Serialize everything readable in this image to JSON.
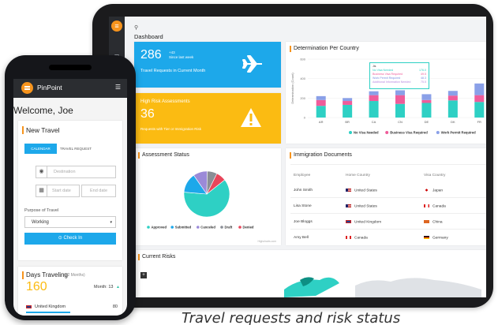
{
  "caption": "Travel requests and risk status",
  "dashboard": {
    "title": "Dashboard",
    "travel_card": {
      "number": "286",
      "delta": "+43",
      "delta_note": "Since last week",
      "caption": "Travel Requests in Current Month"
    },
    "risk_card": {
      "title": "High Risk Assessments",
      "number": "36",
      "caption": "Requests with Tier or Immigration Risk"
    },
    "determination": {
      "title": "Determination Per Country",
      "tooltip": {
        "header": "Jis",
        "rows": [
          {
            "label": "No Visa Needed",
            "value": "176.0"
          },
          {
            "label": "Business Visa Required",
            "value": "49.5"
          },
          {
            "label": "Work Permit Required",
            "value": "48.3"
          },
          {
            "label": "Additional Information Needed",
            "value": "75.5"
          }
        ]
      }
    },
    "assessment": {
      "title": "Assessment Status",
      "credit": "Highcharts.com"
    },
    "immigration": {
      "title": "Immigration Documents",
      "headers": [
        "Employee",
        "Home Country",
        "Visa Country"
      ],
      "rows": [
        {
          "employee": "John Smith",
          "home": "United States",
          "visa": "Japan"
        },
        {
          "employee": "Lisa Stone",
          "home": "United States",
          "visa": "Canada"
        },
        {
          "employee": "Joe Bloggs",
          "home": "United Kingdom",
          "visa": "China"
        },
        {
          "employee": "Amy Bell",
          "home": "Canada",
          "visa": "Germany"
        }
      ]
    },
    "risks": {
      "title": "Current Risks"
    }
  },
  "chart_data": [
    {
      "type": "bar",
      "title": "Determination Per Country",
      "ylabel": "Determination (Count)",
      "categories": [
        "AR",
        "BR",
        "CA",
        "CN",
        "DE",
        "DK",
        "FR"
      ],
      "ylim": [
        0,
        600
      ],
      "yticks": [
        0,
        200,
        400,
        600
      ],
      "series": [
        {
          "name": "No Visa Needed",
          "color": "#2ed0c4",
          "values": [
            120,
            130,
            170,
            140,
            150,
            176,
            160
          ]
        },
        {
          "name": "Business Visa Required",
          "color": "#ef5c9a",
          "values": [
            60,
            40,
            60,
            90,
            30,
            49.5,
            70
          ]
        },
        {
          "name": "Work Permit Required",
          "color": "#8aa0e8",
          "values": [
            40,
            30,
            40,
            50,
            60,
            48.3,
            120
          ]
        }
      ],
      "legend": "bottom"
    },
    {
      "type": "pie",
      "title": "Assessment Status",
      "categories": [
        "Approved",
        "Submitted",
        "Canceled",
        "Draft",
        "Denied"
      ],
      "values": [
        62,
        14,
        10,
        7,
        7
      ],
      "colors": [
        "#2ed0c4",
        "#1da8ea",
        "#9b8ad8",
        "#8a8e96",
        "#e8455a"
      ],
      "legend": "bottom"
    }
  ],
  "phone": {
    "app_name": "PinPoint",
    "welcome": "Welcome, Joe",
    "new_travel": {
      "title": "New Travel",
      "tab_calendar": "CALENDAR",
      "tab_request": "TRAVEL REQUEST",
      "destination_placeholder": "Destination",
      "start_placeholder": "Start date",
      "end_placeholder": "End date",
      "purpose_label": "Purpose of Travel",
      "purpose_value": "Working",
      "checkin": "Check In"
    },
    "days": {
      "title": "Days Traveling",
      "subtitle": "(12 Months)",
      "number": "160",
      "month": "Month: 13",
      "country": "United Kingdom",
      "country_value": "80"
    }
  },
  "colors": {
    "accent": "#f7941d",
    "blue": "#1da8ea",
    "yellow": "#fbbb12",
    "teal": "#2ed0c4"
  }
}
